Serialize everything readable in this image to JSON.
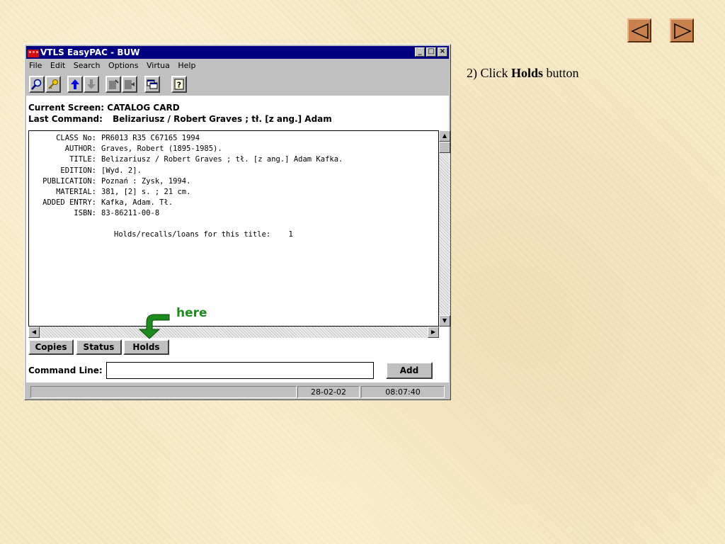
{
  "nav": {
    "prev_icon": "left-triangle-icon",
    "next_icon": "right-triangle-icon"
  },
  "caption": {
    "prefix": "2) Click ",
    "bold": "Holds",
    "suffix": " button"
  },
  "window": {
    "title": "VTLS EasyPAC - BUW",
    "controls": [
      "_",
      "□",
      "×"
    ],
    "menu": [
      "File",
      "Edit",
      "Search",
      "Options",
      "Virtua",
      "Help"
    ],
    "current_screen_label": "Current Screen:",
    "current_screen_value": "CATALOG CARD",
    "last_command_label": "Last Command:",
    "last_command_value": "Belizariusz / Robert Graves ; tł. [z ang.] Adam",
    "catalog": [
      {
        "label": "CLASS No:",
        "value": "PR6013 R35 C67165 1994"
      },
      {
        "label": "AUTHOR:",
        "value": "Graves, Robert (1895-1985)."
      },
      {
        "label": "TITLE:",
        "value": "Belizariusz / Robert Graves ; tł. [z ang.] Adam Kafka."
      },
      {
        "label": "EDITION:",
        "value": "[Wyd. 2]."
      },
      {
        "label": "PUBLICATION:",
        "value": "Poznań : Zysk, 1994."
      },
      {
        "label": "MATERIAL:",
        "value": "381, [2] s. ; 21 cm."
      },
      {
        "label": "ADDED ENTRY:",
        "value": "Kafka, Adam. Tł."
      },
      {
        "label": "ISBN:",
        "value": "83-86211-00-8"
      }
    ],
    "holds_line": "Holds/recalls/loans for this title:    1",
    "tabs": {
      "copies": "Copies",
      "status": "Status",
      "holds": "Holds"
    },
    "command_line_label": "Command Line:",
    "command_line_value": "",
    "add_label": "Add",
    "status_message": "",
    "status_date": "28-02-02",
    "status_time": "08:07:40"
  },
  "annotation": {
    "text": "here",
    "color": "#1f8a1f"
  }
}
